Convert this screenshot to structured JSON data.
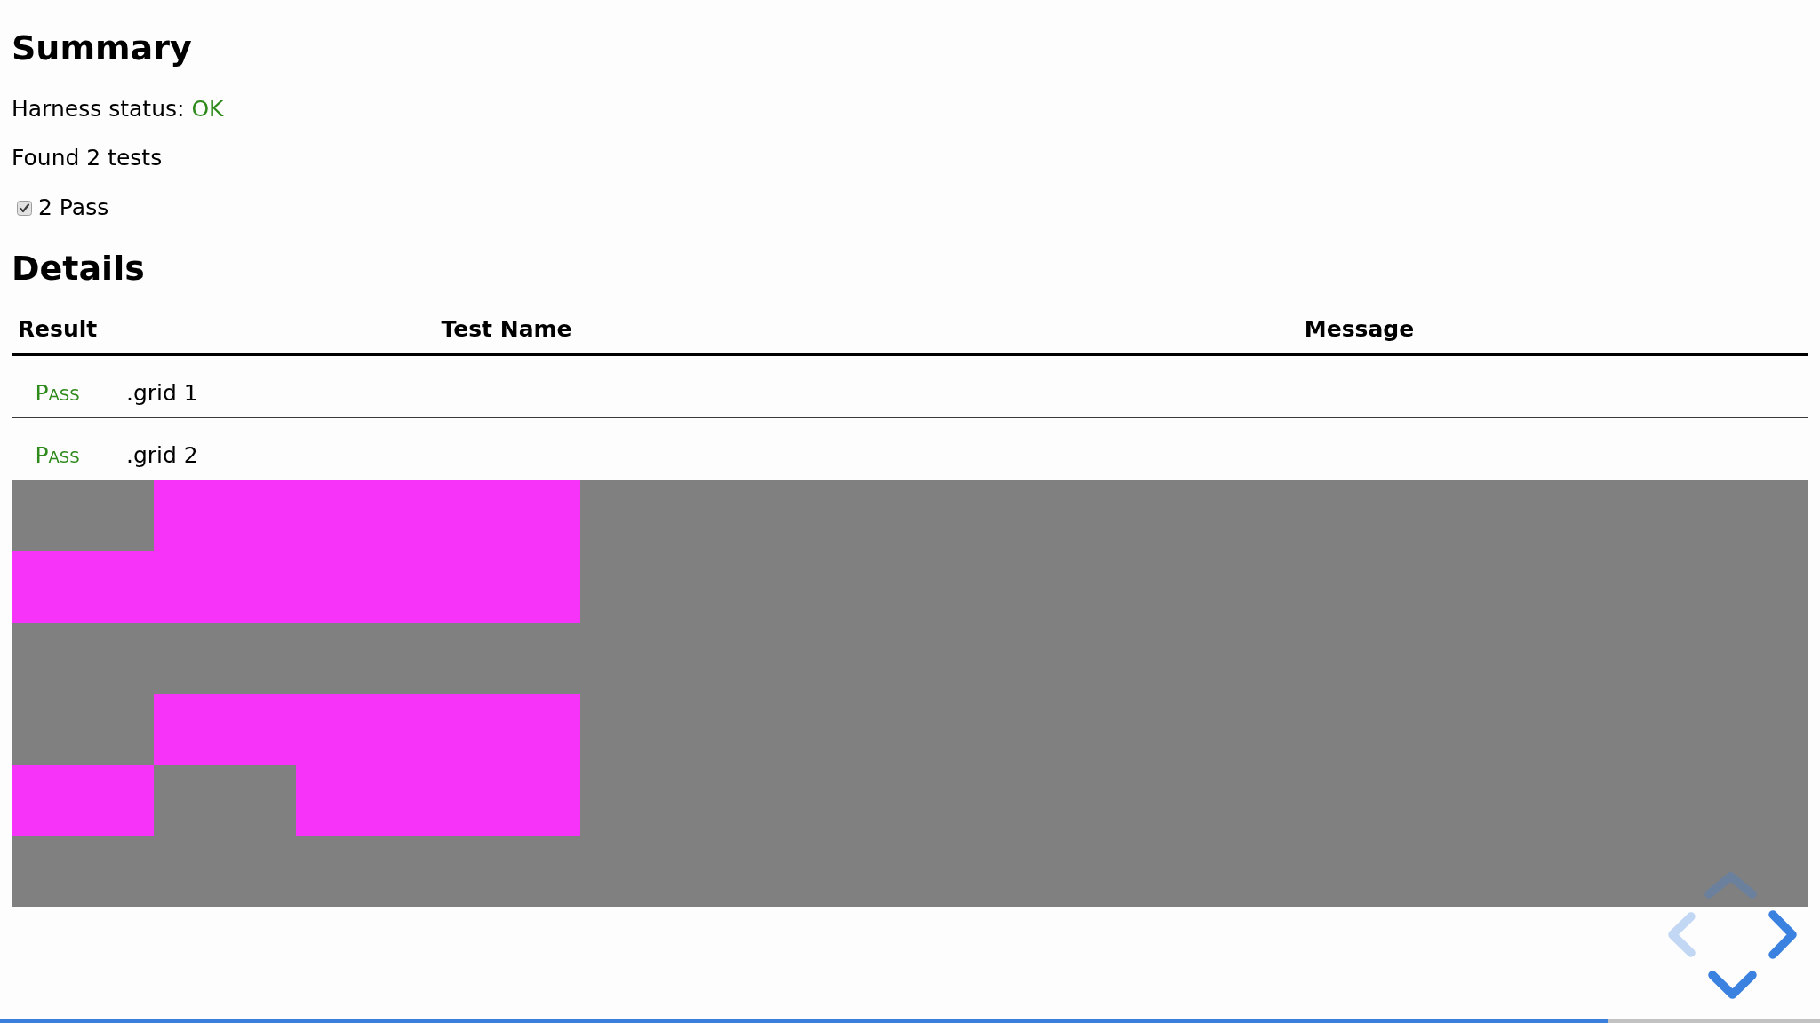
{
  "summary": {
    "heading": "Summary",
    "harness_status": {
      "label": "Harness status:",
      "value": "OK",
      "color": "#2f8a1c"
    },
    "found": "Found 2 tests",
    "filters": [
      {
        "label": "2 Pass",
        "checked": true
      }
    ]
  },
  "details": {
    "heading": "Details",
    "table": {
      "columns": [
        "Result",
        "Test Name",
        "Message"
      ],
      "rows": [
        {
          "result": "Pass",
          "color": "#2f8a1c",
          "test_name": ".grid 1"
        },
        {
          "result": "Pass",
          "color": "#2f8a1c",
          "test_name": ".grid 2"
        }
      ]
    }
  },
  "slide_controls": [
    {
      "kind": "up",
      "disabled": true
    },
    {
      "kind": "left",
      "disabled": true
    },
    {
      "kind": "right",
      "disabled": false
    },
    {
      "kind": "down",
      "disabled": false
    }
  ],
  "progress": {
    "level": 0.884
  }
}
